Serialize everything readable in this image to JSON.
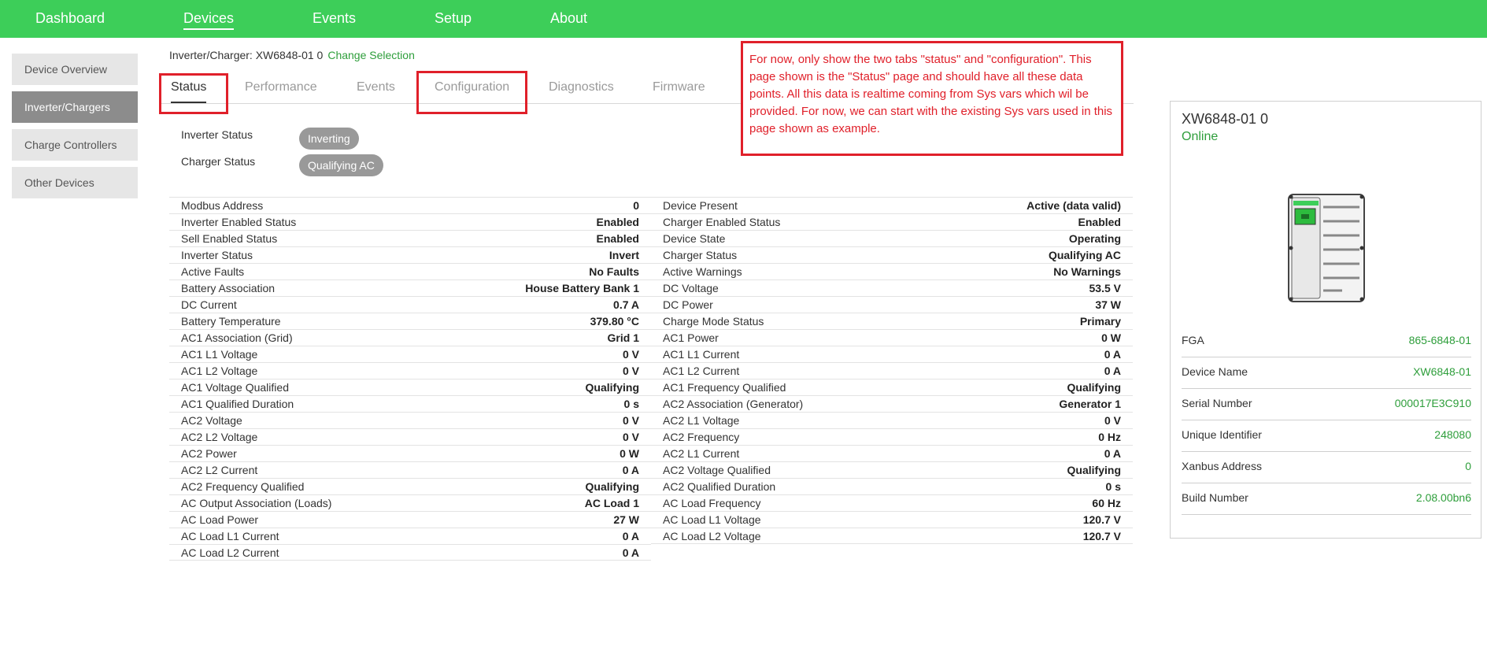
{
  "nav": {
    "items": [
      {
        "label": "Dashboard"
      },
      {
        "label": "Devices"
      },
      {
        "label": "Events"
      },
      {
        "label": "Setup"
      },
      {
        "label": "About"
      }
    ],
    "active": "Devices"
  },
  "sidebar": {
    "items": [
      {
        "label": "Device Overview"
      },
      {
        "label": "Inverter/Chargers"
      },
      {
        "label": "Charge Controllers"
      },
      {
        "label": "Other Devices"
      }
    ],
    "active": "Inverter/Chargers"
  },
  "breadcrumb": {
    "text": "Inverter/Charger: XW6848-01 0",
    "link": "Change Selection"
  },
  "tabs": [
    {
      "label": "Status"
    },
    {
      "label": "Performance"
    },
    {
      "label": "Events"
    },
    {
      "label": "Configuration"
    },
    {
      "label": "Diagnostics"
    },
    {
      "label": "Firmware"
    }
  ],
  "active_tab": "Status",
  "status": {
    "inverter_label": "Inverter Status",
    "inverter_value": "Inverting",
    "charger_label": "Charger Status",
    "charger_value": "Qualifying AC"
  },
  "table_left": [
    {
      "k": "Modbus Address",
      "v": "0"
    },
    {
      "k": "Inverter Enabled Status",
      "v": "Enabled"
    },
    {
      "k": "Sell Enabled Status",
      "v": "Enabled"
    },
    {
      "k": "Inverter Status",
      "v": "Invert"
    },
    {
      "k": "Active Faults",
      "v": "No Faults"
    },
    {
      "k": "Battery Association",
      "v": "House Battery Bank 1"
    },
    {
      "k": "DC Current",
      "v": "0.7 A"
    },
    {
      "k": "Battery Temperature",
      "v": "379.80 °C"
    },
    {
      "k": "AC1 Association (Grid)",
      "v": "Grid 1"
    },
    {
      "k": "AC1 L1 Voltage",
      "v": "0 V"
    },
    {
      "k": "AC1 L2 Voltage",
      "v": "0 V"
    },
    {
      "k": "AC1 Voltage Qualified",
      "v": "Qualifying"
    },
    {
      "k": "AC1 Qualified Duration",
      "v": "0 s"
    },
    {
      "k": "AC2 Voltage",
      "v": "0 V"
    },
    {
      "k": "AC2 L2 Voltage",
      "v": "0 V"
    },
    {
      "k": "AC2 Power",
      "v": "0 W"
    },
    {
      "k": "AC2 L2 Current",
      "v": "0 A"
    },
    {
      "k": "AC2 Frequency Qualified",
      "v": "Qualifying"
    },
    {
      "k": "AC Output Association (Loads)",
      "v": "AC Load 1"
    },
    {
      "k": "AC Load Power",
      "v": "27 W"
    },
    {
      "k": "AC Load L1 Current",
      "v": "0 A"
    },
    {
      "k": "AC Load L2 Current",
      "v": "0 A"
    }
  ],
  "table_right": [
    {
      "k": "Device Present",
      "v": "Active (data valid)"
    },
    {
      "k": "Charger Enabled Status",
      "v": "Enabled"
    },
    {
      "k": "Device State",
      "v": "Operating"
    },
    {
      "k": "Charger Status",
      "v": "Qualifying AC"
    },
    {
      "k": "Active Warnings",
      "v": "No Warnings"
    },
    {
      "k": "DC Voltage",
      "v": "53.5 V"
    },
    {
      "k": "DC Power",
      "v": "37 W"
    },
    {
      "k": "Charge Mode Status",
      "v": "Primary"
    },
    {
      "k": "AC1 Power",
      "v": "0 W"
    },
    {
      "k": "AC1 L1 Current",
      "v": "0 A"
    },
    {
      "k": "AC1 L2 Current",
      "v": "0 A"
    },
    {
      "k": "AC1 Frequency Qualified",
      "v": "Qualifying"
    },
    {
      "k": "AC2 Association (Generator)",
      "v": "Generator 1"
    },
    {
      "k": "AC2 L1 Voltage",
      "v": "0 V"
    },
    {
      "k": "AC2 Frequency",
      "v": "0 Hz"
    },
    {
      "k": "AC2 L1 Current",
      "v": "0 A"
    },
    {
      "k": "AC2 Voltage Qualified",
      "v": "Qualifying"
    },
    {
      "k": "AC2 Qualified Duration",
      "v": "0 s"
    },
    {
      "k": "AC Load Frequency",
      "v": "60 Hz"
    },
    {
      "k": "AC Load L1 Voltage",
      "v": "120.7 V"
    },
    {
      "k": "AC Load L2 Voltage",
      "v": "120.7 V"
    }
  ],
  "note": "For now, only show the two tabs \"status\" and \"configuration\". This page shown is the \"Status\" page and should have all these data points. All this data is realtime coming from Sys vars which wil be provided. For now, we can start with the existing Sys vars used in this page shown as example.",
  "device_card": {
    "title": "XW6848-01 0",
    "status": "Online",
    "info": [
      {
        "k": "FGA",
        "v": "865-6848-01"
      },
      {
        "k": "Device Name",
        "v": "XW6848-01"
      },
      {
        "k": "Serial Number",
        "v": "000017E3C910"
      },
      {
        "k": "Unique Identifier",
        "v": "248080"
      },
      {
        "k": "Xanbus Address",
        "v": "0"
      },
      {
        "k": "Build Number",
        "v": "2.08.00bn6"
      }
    ]
  },
  "colors": {
    "accent": "#3dce59",
    "link": "#2e9e3b",
    "annotation": "#e0202a"
  },
  "icons": [
    "inverter-device-icon"
  ]
}
